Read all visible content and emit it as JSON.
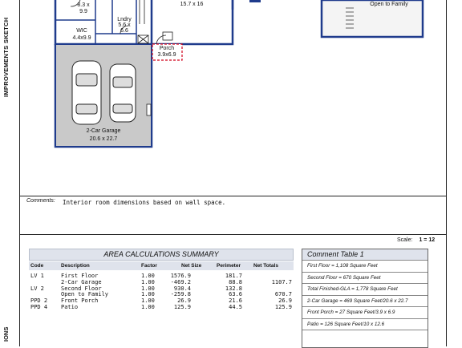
{
  "side": {
    "sketch_label": "IMPROVEMENTS SKETCH",
    "bottom_label": "IONS"
  },
  "plan": {
    "rooms": {
      "bedroom": {
        "dims_w": "8.3 x",
        "dims_h": "9.9"
      },
      "laundry": {
        "name": "Lndry",
        "dims_w": "5.6 x",
        "dims_h": "6.6"
      },
      "living": {
        "dims": "15.7 x 16"
      },
      "wic": {
        "name": "WIC",
        "dims": "4.4x9.9"
      },
      "porch": {
        "name": "Porch",
        "dims": "3.9x6.9"
      },
      "garage": {
        "name": "2-Car Garage",
        "dims": "20.6 x 22.7"
      },
      "family": {
        "name": "Open to Family"
      }
    }
  },
  "comments": {
    "label": "Comments:",
    "text": "Interior room dimensions based on wall space."
  },
  "scale": {
    "label": "Scale:",
    "value": "1 = 12"
  },
  "area_calc": {
    "title": "AREA  CALCULATIONS  SUMMARY",
    "headers": {
      "code": "Code",
      "description": "Description",
      "factor": "Factor",
      "net_size": "Net Size",
      "perimeter": "Perimeter",
      "net_totals": "Net Totals"
    },
    "rows": [
      {
        "code": "LV 1",
        "description": "First Floor",
        "factor": "1.00",
        "net_size": "1576.9",
        "perimeter": "181.7",
        "net_total": ""
      },
      {
        "code": "",
        "description": "2-Car Garage",
        "factor": "1.00",
        "net_size": "-469.2",
        "perimeter": "88.8",
        "net_total": "1107.7"
      },
      {
        "code": "LV 2",
        "description": "Second Floor",
        "factor": "1.00",
        "net_size": "930.4",
        "perimeter": "132.8",
        "net_total": ""
      },
      {
        "code": "",
        "description": "Open to Family",
        "factor": "1.00",
        "net_size": "-259.8",
        "perimeter": "63.6",
        "net_total": "670.7"
      },
      {
        "code": "PPD 2",
        "description": "Front Porch",
        "factor": "1.00",
        "net_size": "26.9",
        "perimeter": "21.6",
        "net_total": "26.9"
      },
      {
        "code": "PPD 4",
        "description": "Patio",
        "factor": "1.00",
        "net_size": "125.9",
        "perimeter": "44.5",
        "net_total": "125.9"
      }
    ]
  },
  "comment_table": {
    "title": "Comment Table 1",
    "rows": [
      "First Floor = 1,108 Square Feet",
      "Second Floor = 670 Square Feet",
      "Total Finished-GLA = 1,778 Square Feet",
      "2-Car Garage = 469 Square Feet/20.6 x 22.7",
      "Front Porch = 27 Square Feet/3.9 x 6.9",
      "Patio = 126 Square Feet/10 x 12.6"
    ]
  },
  "colors": {
    "wall": "#1f3b8c",
    "garage_fill": "#c9c9c9",
    "porch_outline": "#d0021b",
    "header_fill": "#dfe3ec"
  }
}
